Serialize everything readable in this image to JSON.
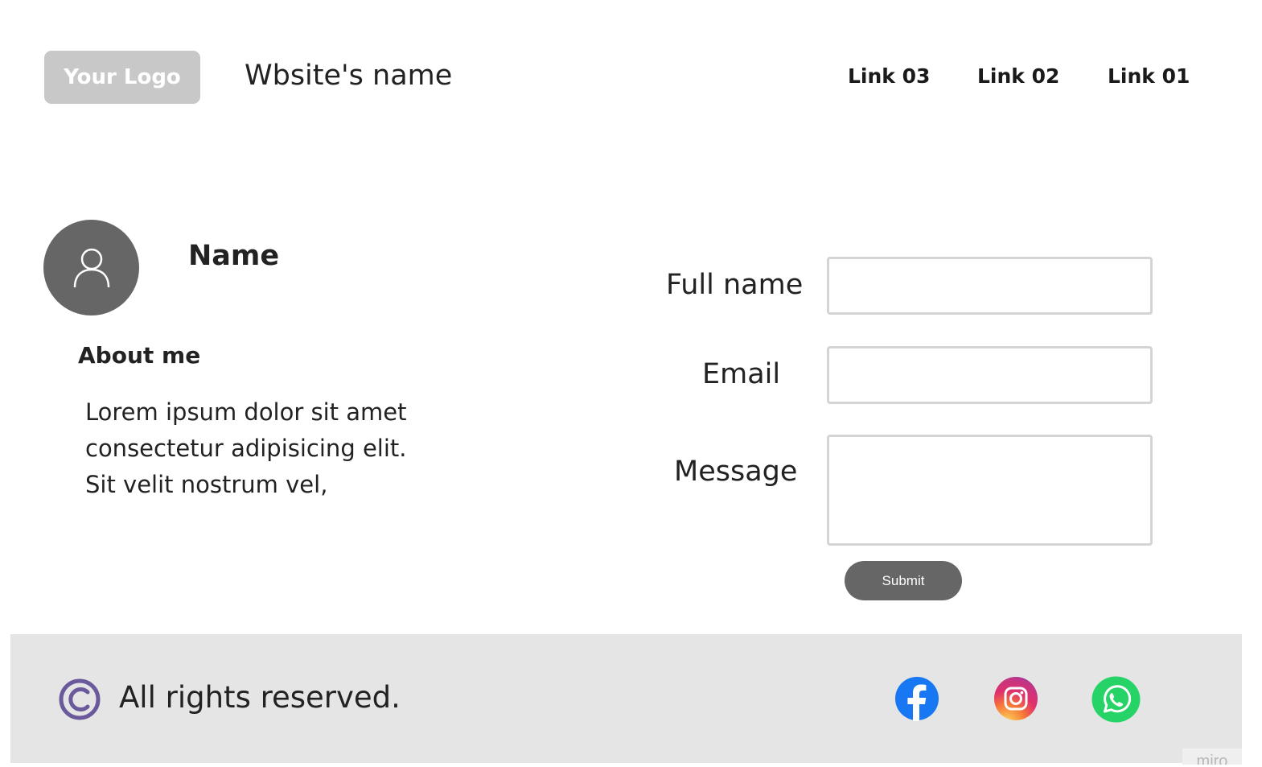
{
  "header": {
    "logo_text": "Your Logo",
    "site_name": "Wbsite's name",
    "nav": [
      {
        "label": "Link 03"
      },
      {
        "label": "Link 02"
      },
      {
        "label": "Link 01"
      }
    ]
  },
  "profile": {
    "avatar_icon": "user-icon",
    "name": "Name",
    "about_heading": "About me",
    "about_lines": [
      "Lorem ipsum dolor sit amet",
      "consectetur adipisicing elit.",
      "Sit velit nostrum vel,"
    ]
  },
  "form": {
    "full_name_label": "Full name",
    "full_name_value": "",
    "email_label": "Email",
    "email_value": "",
    "message_label": "Message",
    "message_value": "",
    "submit_label": "Submit"
  },
  "footer": {
    "copyright_icon": "copyright-icon",
    "rights_text": "All rights reserved.",
    "social": [
      {
        "icon": "facebook-icon"
      },
      {
        "icon": "instagram-icon"
      },
      {
        "icon": "whatsapp-icon"
      }
    ],
    "watermark": "miro"
  },
  "colors": {
    "logo_bg": "#c8c8c8",
    "avatar_bg": "#666666",
    "button_bg": "#666666",
    "footer_bg": "#e5e5e5",
    "field_border": "#d4d4d4",
    "copyright_purple": "#6a5a9c",
    "facebook_blue": "#1877f2",
    "whatsapp_green": "#25d366"
  }
}
